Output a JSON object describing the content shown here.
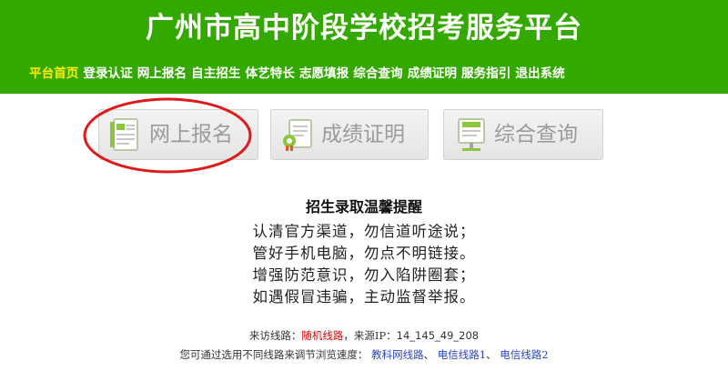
{
  "header": {
    "title": "广州市高中阶段学校招考服务平台",
    "bg_color": "#33a900",
    "nav": [
      {
        "label": "平台首页",
        "active": true
      },
      {
        "label": "登录认证",
        "active": false
      },
      {
        "label": "网上报名",
        "active": false
      },
      {
        "label": "自主招生",
        "active": false
      },
      {
        "label": "体艺特长",
        "active": false
      },
      {
        "label": "志愿填报",
        "active": false
      },
      {
        "label": "综合查询",
        "active": false
      },
      {
        "label": "成绩证明",
        "active": false
      },
      {
        "label": "服务指引",
        "active": false
      },
      {
        "label": "退出系统",
        "active": false
      }
    ]
  },
  "tiles": [
    {
      "label": "网上报名",
      "icon": "registration-form-icon"
    },
    {
      "label": "成绩证明",
      "icon": "score-certificate-icon"
    },
    {
      "label": "综合查询",
      "icon": "query-board-icon"
    }
  ],
  "notice": {
    "title": "招生录取温馨提醒",
    "lines": [
      "认清官方渠道，勿信道听途说；",
      "管好手机电脑，勿点不明链接。",
      "增强防范意识，勿入陷阱圈套；",
      "如遇假冒违骗，主动监督举报。"
    ]
  },
  "route_info": {
    "prefix": "来访线路：",
    "route": "随机线路",
    "sep": "，来源IP：",
    "ip": "14_145_49_208"
  },
  "route_switch": {
    "prefix": "您可通过选用不同线路来调节浏览速度：",
    "links": [
      "教科网线路",
      "电信线路1",
      "电信线路2"
    ],
    "sep": "、"
  }
}
